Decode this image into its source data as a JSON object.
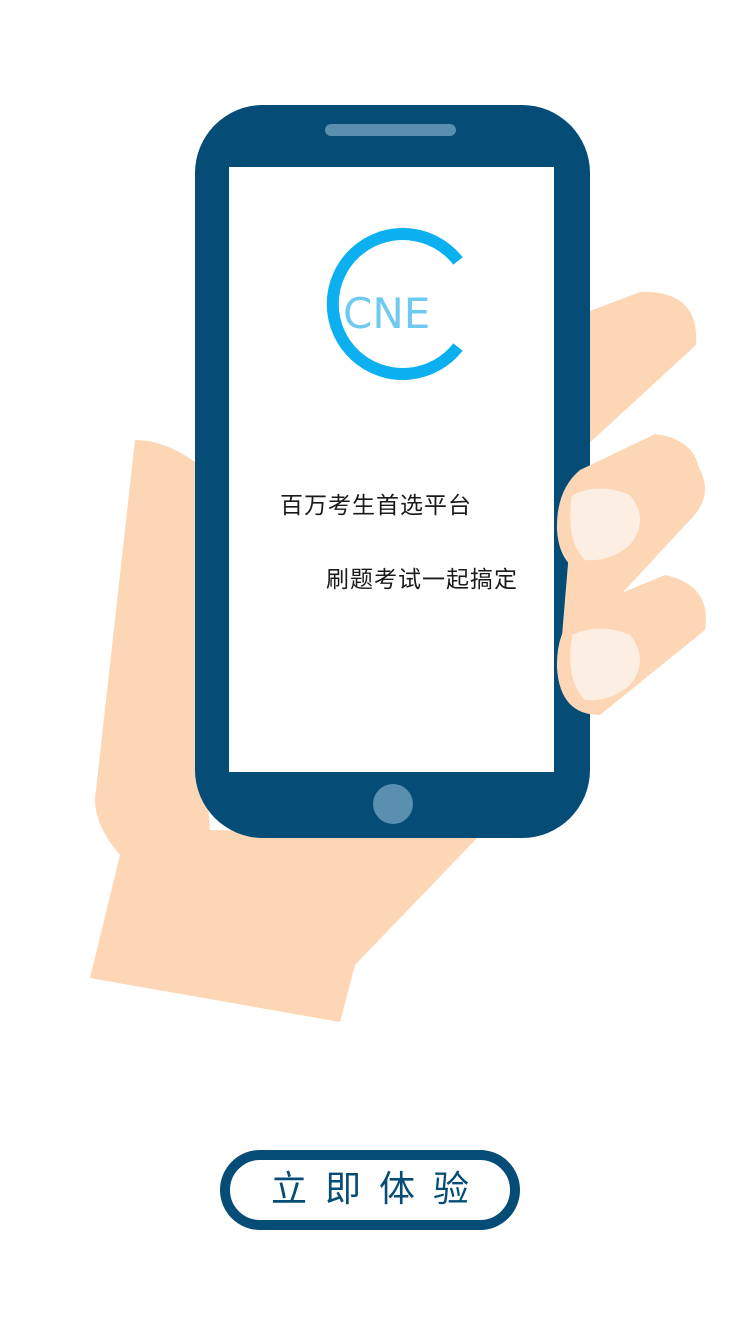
{
  "logo": {
    "text": "CNE",
    "ring_color": "#0cb0f0",
    "letters_color": "#6fcaf2"
  },
  "screen": {
    "tagline_1": "百万考生首选平台",
    "tagline_2": "刷题考试一起搞定"
  },
  "cta": {
    "label": "立即体验"
  },
  "colors": {
    "phone_body": "#054c77",
    "phone_accent": "#5a8fb0",
    "skin": "#fdd7b5",
    "nail": "#fdeee3",
    "background": "#ffffff"
  }
}
